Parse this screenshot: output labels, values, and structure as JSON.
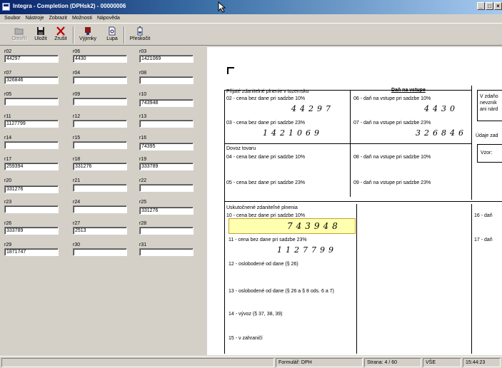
{
  "window": {
    "title": "Integra - Completion (DPHsk2) - 00000006",
    "buttons": {
      "minimize": "_",
      "maximize": "□",
      "close": "×"
    }
  },
  "menu": [
    "Soubor",
    "Nástroje",
    "Zobrazit",
    "Možnosti",
    "Nápověda"
  ],
  "toolbar": {
    "open": "Otevřít",
    "save": "Uložit",
    "cancel": "Zrušit",
    "exceptions": "Výjimky",
    "zoom": "Lupa",
    "skip": "Přeskočit"
  },
  "fields": [
    {
      "label": "r02",
      "value": "44297"
    },
    {
      "label": "r06",
      "value": "4430"
    },
    {
      "label": "r03",
      "value": "1421069"
    },
    {
      "label": "r07",
      "value": "326846"
    },
    {
      "label": "r04",
      "value": ""
    },
    {
      "label": "r08",
      "value": ""
    },
    {
      "label": "r05",
      "value": ""
    },
    {
      "label": "r09",
      "value": ""
    },
    {
      "label": "r10",
      "value": "743948"
    },
    {
      "label": "r11",
      "value": "1127799"
    },
    {
      "label": "r12",
      "value": ""
    },
    {
      "label": "r13",
      "value": ""
    },
    {
      "label": "r14",
      "value": ""
    },
    {
      "label": "r15",
      "value": ""
    },
    {
      "label": "r16",
      "value": "74395"
    },
    {
      "label": "r17",
      "value": "259394"
    },
    {
      "label": "r18",
      "value": "331276"
    },
    {
      "label": "r19",
      "value": "333789"
    },
    {
      "label": "r20",
      "value": "331276"
    },
    {
      "label": "r21",
      "value": ""
    },
    {
      "label": "r22",
      "value": ""
    },
    {
      "label": "r23",
      "value": ""
    },
    {
      "label": "r24",
      "value": ""
    },
    {
      "label": "r25",
      "value": "331276"
    },
    {
      "label": "r26",
      "value": "333789"
    },
    {
      "label": "r27",
      "value": "2513"
    },
    {
      "label": "r28",
      "value": ""
    },
    {
      "label": "r29",
      "value": "1871747"
    },
    {
      "label": "r30",
      "value": ""
    },
    {
      "label": "r31",
      "value": ""
    }
  ],
  "document": {
    "section1_title": "Přijaté zdanitelné plnenie v tuzemsku",
    "tax_header": "Daň na vstupe",
    "r02_label": "02 - cena bez dane pri sadzbe 10%",
    "r02_value": "44297",
    "r06_label": "06 - daň na vstupe pri sadzbe 10%",
    "r06_value": "4430",
    "r03_label": "03 - cena bez dane pri sadzbe 23%",
    "r03_value": "1421069",
    "r07_label": "07 - daň na vstupe pri sadzbe 23%",
    "r07_value": "326846",
    "section2_title": "Dovoz tovaru",
    "r04_label": "04 - cena bez dane pri sadzbe 10%",
    "r08_label": "08 - daň na vstupe pri sadzbe 10%",
    "r05_label": "05 - cena bez dane pri sadzbe 23%",
    "r09_label": "09 - daň na vstupe pri sadzbe 23%",
    "section3_title": "Uskutočnené zdaniteľné plnenia",
    "r10_label": "10 - cena bez dane pri sadzbe 10%",
    "r10_value": "743948",
    "r11_label": "11 - cena bez dane pri sadzbe 23%",
    "r11_value": "1127799",
    "r12_label": "12 - oslobodené od dane (§ 26)",
    "r13_label": "13 - oslobodené od dane (§ 26 a § 8 ods. 6 a 7)",
    "r14_label": "14 - vývoz (§ 37, 38, 39)",
    "r15_label": "15 - v zahraničí",
    "side_box1": "V zdaňo\nnevznik\nani nárd",
    "side_label": "Údaje zad",
    "side_box2": "Vzor:",
    "r16_label": "16 - daň",
    "r17_label": "17 - daň"
  },
  "status": {
    "form": "Formulář: DPH",
    "page": "Strana: 4 / 60",
    "scope": "VŠE",
    "time": "15:44:23"
  }
}
